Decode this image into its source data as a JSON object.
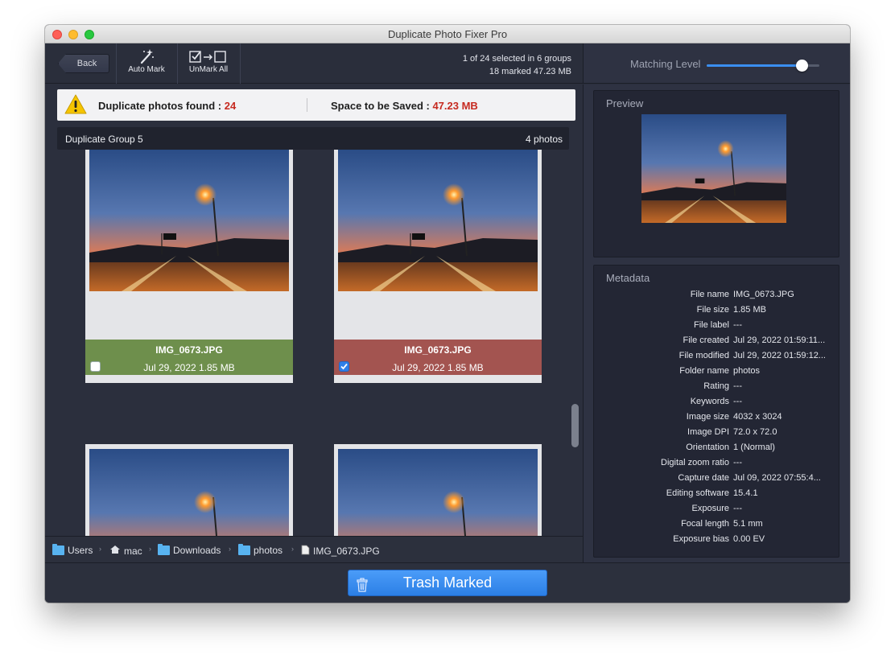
{
  "window": {
    "title": "Duplicate Photo Fixer Pro"
  },
  "toolbar": {
    "back_label": "Back",
    "auto_mark_label": "Auto Mark",
    "unmark_all_label": "UnMark All",
    "selection_line1": "1 of 24 selected in 6 groups",
    "selection_line2": "18 marked 47.23 MB"
  },
  "matching": {
    "label": "Matching Level",
    "level": 0.84
  },
  "summary": {
    "duplicates_label": "Duplicate photos found : ",
    "duplicates_value": "24",
    "space_label": "Space to be Saved : ",
    "space_value": "47.23 MB"
  },
  "group": {
    "title": "Duplicate Group 5",
    "count": "4 photos"
  },
  "photos": [
    {
      "name": "IMG_0673.JPG",
      "meta": "Jul 29, 2022 1.85 MB",
      "checked": false,
      "status_color": "#6e8f4c"
    },
    {
      "name": "IMG_0673.JPG",
      "meta": "Jul 29, 2022 1.85 MB",
      "checked": true,
      "status_color": "#a35450"
    }
  ],
  "path": {
    "items": [
      "Users",
      "mac",
      "Downloads",
      "photos",
      "IMG_0673.JPG"
    ]
  },
  "preview": {
    "label": "Preview"
  },
  "metadata": {
    "label": "Metadata",
    "rows": [
      {
        "key": "File name",
        "value": "IMG_0673.JPG"
      },
      {
        "key": "File size",
        "value": "1.85 MB"
      },
      {
        "key": "File label",
        "value": "---"
      },
      {
        "key": "File created",
        "value": "Jul 29, 2022 01:59:11..."
      },
      {
        "key": "File modified",
        "value": "Jul 29, 2022 01:59:12..."
      },
      {
        "key": "Folder name",
        "value": "photos"
      },
      {
        "key": "Rating",
        "value": "---"
      },
      {
        "key": "Keywords",
        "value": "---"
      },
      {
        "key": "Image size",
        "value": "4032 x 3024"
      },
      {
        "key": "Image DPI",
        "value": "72.0 x 72.0"
      },
      {
        "key": "Orientation",
        "value": "1 (Normal)"
      },
      {
        "key": "Digital zoom ratio",
        "value": "---"
      },
      {
        "key": "Capture date",
        "value": "Jul 09, 2022 07:55:4..."
      },
      {
        "key": "Editing software",
        "value": "15.4.1"
      },
      {
        "key": "Exposure",
        "value": "---"
      },
      {
        "key": "Focal length",
        "value": "5.1 mm"
      },
      {
        "key": "Exposure bias",
        "value": "0.00 EV"
      }
    ]
  },
  "bottom": {
    "trash_label": "Trash Marked"
  },
  "colors": {
    "accent": "#3a8ef0",
    "warning": "#f5c400",
    "highlight": "#c62a20"
  }
}
